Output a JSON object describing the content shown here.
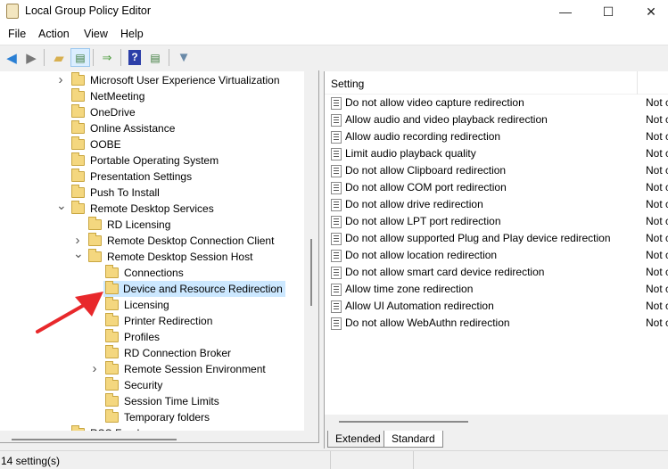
{
  "window": {
    "title": "Local Group Policy Editor",
    "minimize": "—",
    "maximize": "☐",
    "close": "✕"
  },
  "menu": [
    "File",
    "Action",
    "View",
    "Help"
  ],
  "toolbar": [
    "back-icon",
    "forward-icon",
    "up-folder-icon",
    "show-hide-console-tree-icon",
    "export-list-icon",
    "help-icon",
    "show-hide-action-pane-icon",
    "filter-icon"
  ],
  "tree": [
    {
      "label": "Microsoft User Experience Virtualization",
      "level": 1,
      "expander": "collapsed"
    },
    {
      "label": "NetMeeting",
      "level": 1
    },
    {
      "label": "OneDrive",
      "level": 1
    },
    {
      "label": "Online Assistance",
      "level": 1
    },
    {
      "label": "OOBE",
      "level": 1
    },
    {
      "label": "Portable Operating System",
      "level": 1
    },
    {
      "label": "Presentation Settings",
      "level": 1
    },
    {
      "label": "Push To Install",
      "level": 1
    },
    {
      "label": "Remote Desktop Services",
      "level": 1,
      "expander": "expanded"
    },
    {
      "label": "RD Licensing",
      "level": 2
    },
    {
      "label": "Remote Desktop Connection Client",
      "level": 2,
      "expander": "collapsed"
    },
    {
      "label": "Remote Desktop Session Host",
      "level": 2,
      "expander": "expanded"
    },
    {
      "label": "Connections",
      "level": 3
    },
    {
      "label": "Device and Resource Redirection",
      "level": 3,
      "selected": true
    },
    {
      "label": "Licensing",
      "level": 3
    },
    {
      "label": "Printer Redirection",
      "level": 3
    },
    {
      "label": "Profiles",
      "level": 3
    },
    {
      "label": "RD Connection Broker",
      "level": 3
    },
    {
      "label": "Remote Session Environment",
      "level": 3,
      "expander": "collapsed"
    },
    {
      "label": "Security",
      "level": 3
    },
    {
      "label": "Session Time Limits",
      "level": 3
    },
    {
      "label": "Temporary folders",
      "level": 3
    },
    {
      "label": "RSS Feeds",
      "level": 1
    }
  ],
  "list": {
    "header": "Setting",
    "rows": [
      {
        "setting": "Do not allow video capture redirection",
        "state": "Not c"
      },
      {
        "setting": "Allow audio and video playback redirection",
        "state": "Not c"
      },
      {
        "setting": "Allow audio recording redirection",
        "state": "Not c"
      },
      {
        "setting": "Limit audio playback quality",
        "state": "Not c"
      },
      {
        "setting": "Do not allow Clipboard redirection",
        "state": "Not c"
      },
      {
        "setting": "Do not allow COM port redirection",
        "state": "Not c"
      },
      {
        "setting": "Do not allow drive redirection",
        "state": "Not c"
      },
      {
        "setting": "Do not allow LPT port redirection",
        "state": "Not c"
      },
      {
        "setting": "Do not allow supported Plug and Play device redirection",
        "state": "Not c"
      },
      {
        "setting": "Do not allow location redirection",
        "state": "Not c"
      },
      {
        "setting": "Do not allow smart card device redirection",
        "state": "Not c"
      },
      {
        "setting": "Allow time zone redirection",
        "state": "Not c"
      },
      {
        "setting": "Allow UI Automation redirection",
        "state": "Not c"
      },
      {
        "setting": "Do not allow WebAuthn redirection",
        "state": "Not c"
      }
    ]
  },
  "tabs": {
    "extended": "Extended",
    "standard": "Standard",
    "active": "Standard"
  },
  "status": "14 setting(s)",
  "colors": {
    "selection": "#cce8ff",
    "arrow": "#e8282b",
    "folder": "#f4d77f"
  }
}
